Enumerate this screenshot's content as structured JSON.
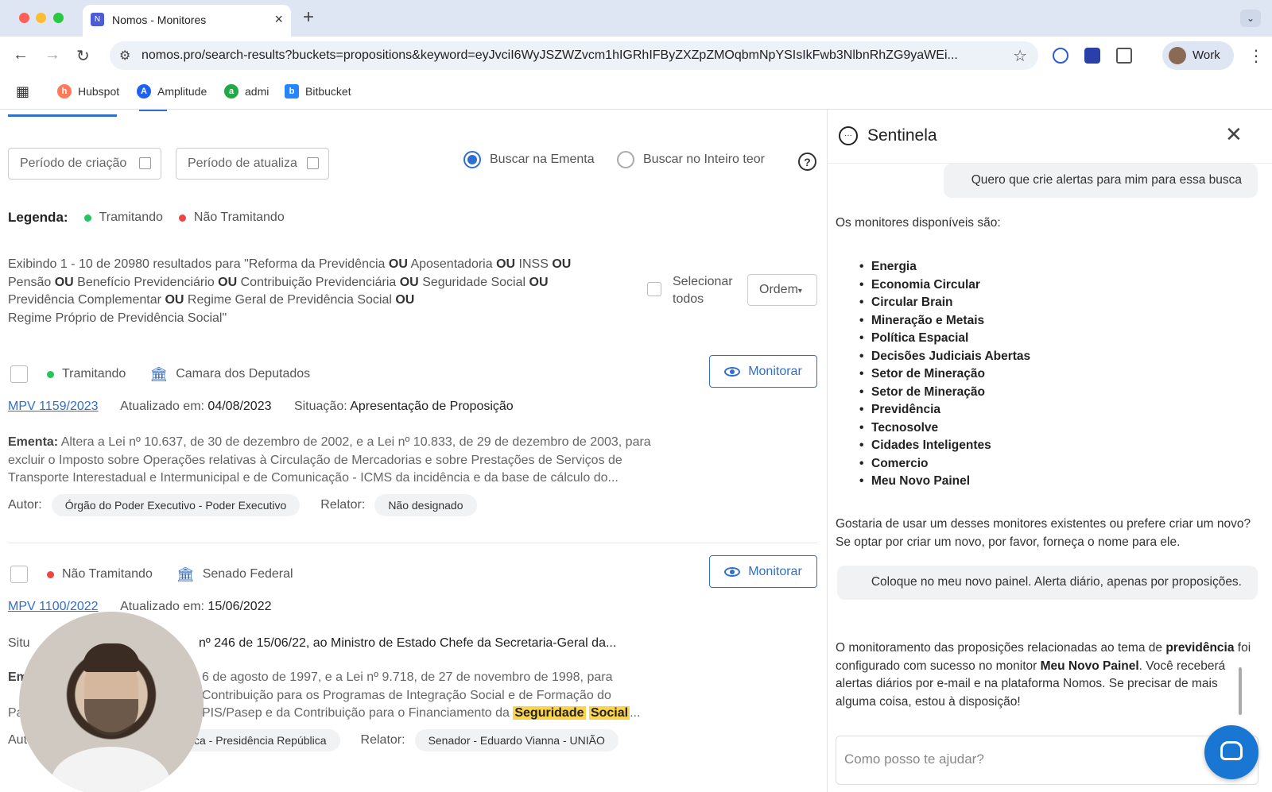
{
  "browser": {
    "tab_title": "Nomos - Monitores",
    "url": "nomos.pro/search-results?buckets=propositions&keyword=eyJvciI6WyJSZWZvcm1hIGRhIFByZXZpZMOqbmNpYSIsIkFwb3NlbnRhZG9yaWEi...",
    "profile_label": "Work",
    "bookmarks": [
      "Hubspot",
      "Amplitude",
      "admi",
      "Bitbucket"
    ]
  },
  "filters": {
    "created_placeholder": "Período de criação",
    "updated_placeholder": "Período de atualiza",
    "radio_ementa": "Buscar na Ementa",
    "radio_inteiro": "Buscar no Inteiro teor",
    "help": "?"
  },
  "legend": {
    "title": "Legenda:",
    "tramitando": "Tramitando",
    "nao_tramitando": "Não Tramitando"
  },
  "summary": {
    "prefix": "Exibindo 1 - 10 de 20980 resultados para  \"Reforma da Previdência",
    "or": "OU",
    "terms": [
      "Aposentadoria",
      "INSS",
      "Pensão",
      "Benefício Previdenciário",
      "Contribuição Previdenciária",
      "Seguridade Social",
      "Previdência Complementar",
      "Regime Geral de Previdência Social",
      "Regime Próprio de Previdência Social\""
    ],
    "select_all": "Selecionar todos",
    "order": "Ordem"
  },
  "results": [
    {
      "status": "Tramitando",
      "house": "Camara dos Deputados",
      "monitor": "Monitorar",
      "code": "MPV 1159/2023",
      "updated_label": "Atualizado em:",
      "updated": "04/08/2023",
      "situation_label": "Situação:",
      "situation": "Apresentação de Proposição",
      "ementa_label": "Ementa:",
      "ementa": "Altera a Lei nº 10.637, de 30 de dezembro de 2002, e a Lei nº 10.833, de 29 de dezembro de 2003, para excluir o Imposto sobre Operações relativas à Circulação de Mercadorias e sobre Prestações de Serviços de Transporte Interestadual e Intermunicipal e de Comunicação - ICMS da incidência e da base de cálculo do...",
      "author_label": "Autor:",
      "author": "Órgão do Poder Executivo - Poder Executivo",
      "relator_label": "Relator:",
      "relator": "Não designado"
    },
    {
      "status": "Não Tramitando",
      "house": "Senado Federal",
      "monitor": "Monitorar",
      "code": "MPV 1100/2022",
      "updated_label": "Atualizado em:",
      "updated": "15/06/2022",
      "situation_label": "Situ",
      "situation": "nº 246 de 15/06/22, ao Ministro de Estado Chefe da Secretaria-Geral da...",
      "ementa_label": "Em",
      "ementa_line1": "6 de agosto de 1997, e a Lei nº 9.718, de 27 de novembro de 1998, para",
      "ementa_line2": "Contribuição para os Programas de Integração Social e de Formação do",
      "ementa_line3_prefix": "Pa",
      "ementa_line3": "PIS/Pasep e da Contribuição para o Financiamento da",
      "highlight1": "Seguridade",
      "highlight2": "Social",
      "ellipsis": "...",
      "author_label": "Autor",
      "author": "ca - Presidência República",
      "relator_label": "Relator:",
      "relator": "Senador - Eduardo Vianna - UNIÃO"
    }
  ],
  "panel": {
    "title": "Sentinela",
    "user_msg1": "Quero que crie alertas para mim para essa busca",
    "bot_intro": "Os monitores disponíveis são:",
    "monitors": [
      "Energia",
      "Economia Circular",
      "Circular Brain",
      "Mineração e Metais",
      "Política Espacial",
      "Decisões Judiciais Abertas",
      "Setor de Mineração",
      "Setor de Mineração",
      "Previdência",
      "Tecnosolve",
      "Cidades Inteligentes",
      "Comercio",
      "Meu Novo Painel"
    ],
    "bot_question": "Gostaria de usar um desses monitores existentes ou prefere criar um novo? Se optar por criar um novo, por favor, forneça o nome para ele.",
    "user_msg2": "Coloque no meu novo painel. Alerta diário, apenas por proposições.",
    "bot_confirm_a": "O monitoramento das proposições relacionadas ao tema de",
    "bot_confirm_topic": "previdência",
    "bot_confirm_b": "foi configurado com sucesso no monitor",
    "bot_confirm_monitor": "Meu Novo Painel",
    "bot_confirm_c": ". Você receberá alertas diários por e-mail e na plataforma Nomos. Se precisar de mais alguma coisa, estou à disposição!",
    "input_placeholder": "Como posso te ajudar?"
  }
}
